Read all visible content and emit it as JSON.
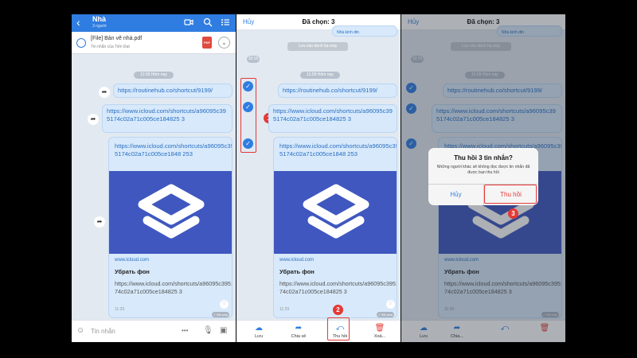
{
  "panel1": {
    "header": {
      "back_icon": "chevron-left-icon",
      "title": "Nhà",
      "subtitle": "3 người"
    },
    "pinned": {
      "file_name": "[File] Bản vẽ nhà.pdf",
      "sender": "Tin nhắn của Tiến Đạt",
      "file_badge": "PDF"
    },
    "compose_placeholder": "Tin nhắn",
    "compose_more": "•••"
  },
  "panel2": {
    "cancel": "Hủy",
    "title": "Đã chọn: 3",
    "actions": [
      {
        "label": "Lưu",
        "icon": "cloud-icon"
      },
      {
        "label": "Chia sẻ",
        "icon": "share-icon"
      },
      {
        "label": "Thu hồi",
        "icon": "recall-icon"
      },
      {
        "label": "Xoá...",
        "icon": "trash-icon"
      }
    ]
  },
  "panel3": {
    "cancel": "Hủy",
    "title": "Đã chọn: 3",
    "dialog": {
      "title": "Thu hồi 3 tin nhắn?",
      "desc": "Những người khác sẽ không đọc được tin nhắn đã được bạn thu hồi",
      "cancel": "Hủy",
      "confirm": "Thu hồi"
    },
    "actions": [
      {
        "label": "Lưu"
      },
      {
        "label": "Chia..."
      }
    ]
  },
  "top_stub": {
    "link_fragment": "Nhà kinh dtn",
    "save_contact": "Lưu vào danh bạ máy",
    "time": "10:15"
  },
  "chat": {
    "time_pill": "11:09 Hôm nay",
    "msg1": "https://routinehub.co/shortcut/9199/",
    "msg2": "https://www.icloud.com/shortcuts/a96095c395174c02a71c005ce184825 3",
    "card": {
      "link": "https://www.icloud.com/shortcuts/a96095c395174c02a71c005ce1848 253",
      "domain": "www.icloud.com",
      "title": "Убрать фон",
      "url": "https://www.icloud.com/shortcuts/a96095c395174c02a71c005ce184825 3",
      "time": "11:29",
      "seen": "✓ Đã xem"
    }
  },
  "annotations": {
    "n1": "1",
    "n2": "2",
    "n3": "3"
  },
  "colors": {
    "accent": "#2f7de1",
    "annotation": "#e53935",
    "bubble": "#d7e9fb",
    "shortcut_bg": "#3f57bf"
  }
}
